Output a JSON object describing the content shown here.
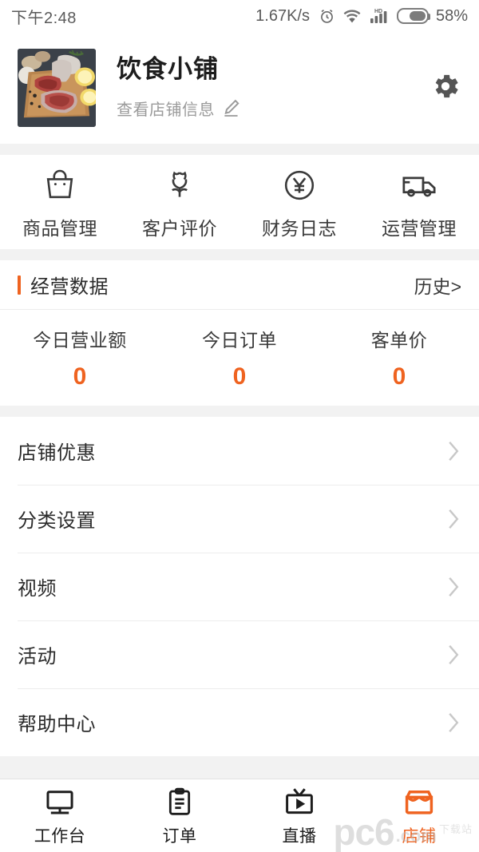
{
  "status_bar": {
    "time": "下午2:48",
    "network_speed": "1.67K/s",
    "alarm_icon": "alarm-clock-icon",
    "wifi_icon": "wifi-icon",
    "signal_icon": "hd-signal-icon",
    "signal_label": "HD",
    "battery_icon": "battery-icon",
    "battery_percent": "58%"
  },
  "shop_header": {
    "avatar_icon": "shop-photo-raw-meat-cutting-board",
    "name": "饮食小铺",
    "subtitle": "查看店铺信息",
    "edit_icon": "pencil-icon",
    "settings_icon": "gear-icon"
  },
  "quick_actions": [
    {
      "label": "商品管理",
      "icon": "shopping-bag-icon"
    },
    {
      "label": "客户评价",
      "icon": "flower-icon"
    },
    {
      "label": "财务日志",
      "icon": "yen-circle-icon"
    },
    {
      "label": "运营管理",
      "icon": "truck-icon"
    }
  ],
  "business_data": {
    "title": "经营数据",
    "history_link": "历史>",
    "accent_color": "#ef6320",
    "stats": [
      {
        "label": "今日营业额",
        "value": "0"
      },
      {
        "label": "今日订单",
        "value": "0"
      },
      {
        "label": "客单价",
        "value": "0"
      }
    ]
  },
  "menu": [
    {
      "label": "店铺优惠",
      "chevron": "chevron-right-icon"
    },
    {
      "label": "分类设置",
      "chevron": "chevron-right-icon"
    },
    {
      "label": "视频",
      "chevron": "chevron-right-icon"
    },
    {
      "label": "活动",
      "chevron": "chevron-right-icon"
    },
    {
      "label": "帮助中心",
      "chevron": "chevron-right-icon"
    }
  ],
  "tabbar": {
    "active_index": 3,
    "active_color": "#ef6320",
    "items": [
      {
        "label": "工作台",
        "icon": "monitor-icon"
      },
      {
        "label": "订单",
        "icon": "clipboard-icon"
      },
      {
        "label": "直播",
        "icon": "tv-play-icon"
      },
      {
        "label": "店铺",
        "icon": "storefront-icon"
      }
    ]
  },
  "watermark": {
    "main": "pc6",
    "suffix": ".com",
    "cn": "下载站"
  }
}
